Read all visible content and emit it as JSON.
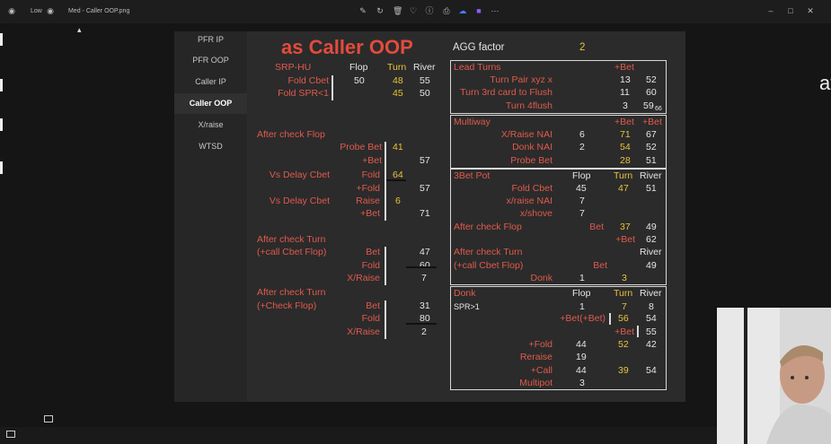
{
  "window": {
    "tab1": "Low",
    "tab2": "Med - Caller OOP.png"
  },
  "icons": [
    "pen-icon",
    "rotate-icon",
    "trash-icon",
    "heart-icon",
    "info-icon",
    "print-icon",
    "cloud-icon",
    "app-icon",
    "more-icon",
    "minimize-icon",
    "maximize-icon",
    "close-icon"
  ],
  "window_controls": {
    "minimize": "–",
    "maximize": "□",
    "close": "✕"
  },
  "right_partial_text": "at",
  "sidebar": {
    "items": [
      "PFR IP",
      "PFR OOP",
      "Caller IP",
      "Caller OOP",
      "X/raise",
      "WTSD"
    ],
    "active": "Caller OOP"
  },
  "title": "as Caller OOP",
  "agg": {
    "label": "AGG factor",
    "value": "2"
  },
  "srp": {
    "header": "SRP-HU",
    "cols": [
      "Flop",
      "Turn",
      "River"
    ],
    "rows": [
      {
        "label": "Fold Cbet",
        "flop": "50",
        "turn": "48",
        "river": "55"
      },
      {
        "label": "Fold SPR<1",
        "flop": "",
        "turn": "45",
        "river": "50"
      }
    ]
  },
  "after_check_flop": {
    "header": "After check Flop",
    "probe_label": "Probe Bet",
    "probe_turn": "41",
    "probe_bet_label": "+Bet",
    "probe_bet_river": "57",
    "delay1_label": "Vs Delay Cbet",
    "delay1_action": "Fold",
    "delay1_turn": "64",
    "delay1_fold_label": "+Fold",
    "delay1_fold_river": "57",
    "delay2_label": "Vs Delay Cbet",
    "delay2_action": "Raise",
    "delay2_turn": "6",
    "delay2_bet_label": "+Bet",
    "delay2_bet_river": "71"
  },
  "after_check_turn_call": {
    "header1": "After check Turn",
    "header2": "(+call Cbet Flop)",
    "rows": [
      {
        "label": "Bet",
        "river": "47"
      },
      {
        "label": "Fold",
        "river": "60"
      },
      {
        "label": "X/Raise",
        "river": "7"
      }
    ]
  },
  "after_check_turn_check": {
    "header1": "After check Turn",
    "header2": "(+Check Flop)",
    "rows": [
      {
        "label": "Bet",
        "river": "31"
      },
      {
        "label": "Fold",
        "river": "80"
      },
      {
        "label": "X/Raise",
        "river": "2"
      }
    ]
  },
  "lead_turns": {
    "header": "Lead Turns",
    "col": "+Bet",
    "rows": [
      {
        "label": "Turn Pair xyz x",
        "turn": "13",
        "river": "52"
      },
      {
        "label": "Turn 3rd card to Flush",
        "turn": "11",
        "river": "60"
      },
      {
        "label": "Turn 4flush",
        "turn": "3",
        "river": "59",
        "river_sub": "66"
      }
    ]
  },
  "multiway": {
    "header": "Multiway",
    "col1": "+Bet",
    "col2": "+Bet",
    "rows": [
      {
        "label": "X/Raise NAI",
        "flop": "6",
        "turn": "71",
        "river": "67"
      },
      {
        "label": "Donk NAI",
        "flop": "2",
        "turn": "54",
        "river": "52"
      },
      {
        "label": "Probe Bet",
        "flop": "",
        "turn": "28",
        "river": "51"
      }
    ]
  },
  "threebet": {
    "header": "3Bet Pot",
    "cols": [
      "Flop",
      "Turn",
      "River"
    ],
    "rows": [
      {
        "label": "Fold Cbet",
        "flop": "45",
        "turn": "47",
        "river": "51"
      },
      {
        "label": "x/raise NAI",
        "flop": "7",
        "turn": "",
        "river": ""
      },
      {
        "label": "x/shove",
        "flop": "7",
        "turn": "",
        "river": ""
      }
    ],
    "acf_label": "After check Flop",
    "acf_bet": "Bet",
    "acf_turn": "37",
    "acf_river": "49",
    "acf_plusbet": "+Bet",
    "acf_plusbet_river": "62",
    "act_label1": "After check Turn",
    "act_label2": "(+call Cbet Flop)",
    "act_river_col": "River",
    "act_bet": "Bet",
    "act_bet_river": "49",
    "donk_label": "Donk",
    "donk_flop": "1",
    "donk_turn": "3"
  },
  "donk": {
    "header": "Donk",
    "cols": [
      "Flop",
      "Turn",
      "River"
    ],
    "spr_label": "SPR>1",
    "spr_flop": "1",
    "spr_turn": "7",
    "spr_river": "8",
    "betbet_label": "+Bet(+Bet)",
    "betbet_turn": "56",
    "betbet_river": "54",
    "bet_label": "+Bet",
    "bet_river": "55",
    "rows": [
      {
        "label": "+Fold",
        "flop": "44",
        "turn": "52",
        "river": "42"
      },
      {
        "label": "Reraise",
        "flop": "19",
        "turn": "",
        "river": ""
      },
      {
        "label": "+Call",
        "flop": "44",
        "turn": "39",
        "river": "54"
      },
      {
        "label": "Multipot",
        "flop": "3",
        "turn": "",
        "river": ""
      }
    ]
  }
}
